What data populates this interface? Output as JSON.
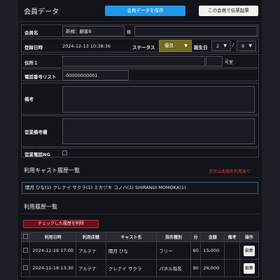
{
  "header": {
    "title": "会員データ",
    "save_label": "会員データを保存",
    "print_label": "この会員で伝票起票"
  },
  "form": {
    "name_label": "会員名",
    "name_value": "新規：顧客B",
    "name_suffix": "様",
    "registered_label": "登録日時",
    "registered_value": "2024-12-13 10:38:36",
    "status_label": "ステータス",
    "status_value": "優良",
    "birthday_label": "誕生日",
    "birth_month": "2",
    "birth_day": "9",
    "address_label": "住所１",
    "address_value": "",
    "room_suffix": "号室",
    "phone_list_label": "電話番号リスト",
    "phone_value": "00000000001",
    "notes_label": "備考",
    "sales_notes_label": "営業備考欄",
    "sales_ng_label": "営業電話NG"
  },
  "cast_history": {
    "title": "利用キャスト履歴一覧",
    "hint": "赤字は本指名利用あり",
    "names": "闇月 ひな(1)  クレナイ サクラ(1)  ミカヅキ コノハ(1)  SHIRANUI MOMOKA(1)"
  },
  "usage_history": {
    "title": "利用履歴一覧",
    "delete_label": "チェックした履歴を削除",
    "columns": [
      "",
      "利用日時",
      "利用店舗",
      "キャスト名",
      "指名種別",
      "分",
      "金額",
      "備考",
      "操作"
    ],
    "rows": [
      {
        "date": "2024-12-19 17:00",
        "store": "アルテナ",
        "cast": "闇月 ひな",
        "type": "フリー",
        "minutes": "60",
        "amount": "15,000",
        "note": "",
        "action": "編集"
      },
      {
        "date": "2024-12-18 13:30",
        "store": "アルテナ",
        "cast": "クレナイ サクラ",
        "type": "パネル指名",
        "minutes": "90",
        "amount": "26,000",
        "note": "",
        "action": "編集"
      }
    ]
  },
  "colors": {
    "accent": "#2197e8",
    "status_olive": "#706b1e",
    "danger": "#e33b3b",
    "delete_bg": "#6a1018"
  }
}
